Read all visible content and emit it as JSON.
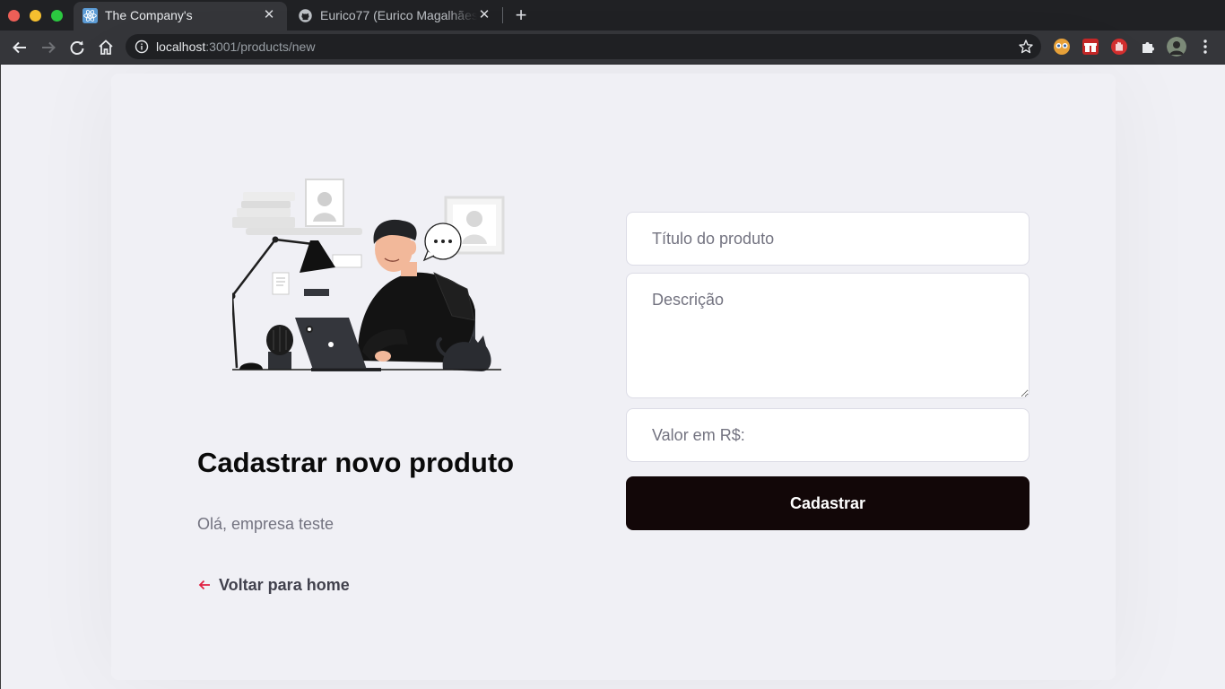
{
  "browser": {
    "tabs": [
      {
        "title": "The Company's",
        "active": true,
        "favicon": "react-icon"
      },
      {
        "title": "Eurico77 (Eurico Magalhães",
        "active": false,
        "favicon": "github-icon"
      }
    ],
    "address": {
      "host": "localhost",
      "rest": ":3001/products/new"
    }
  },
  "page": {
    "title": "Cadastrar novo produto",
    "greeting": "Olá, empresa teste",
    "back_link": "Voltar para home",
    "form": {
      "title_placeholder": "Título do produto",
      "description_placeholder": "Descrição",
      "value_placeholder": "Valor em R$:",
      "submit_label": "Cadastrar"
    }
  },
  "colors": {
    "accent": "#e02041",
    "button": "#120708",
    "background": "#f0f0f5"
  }
}
